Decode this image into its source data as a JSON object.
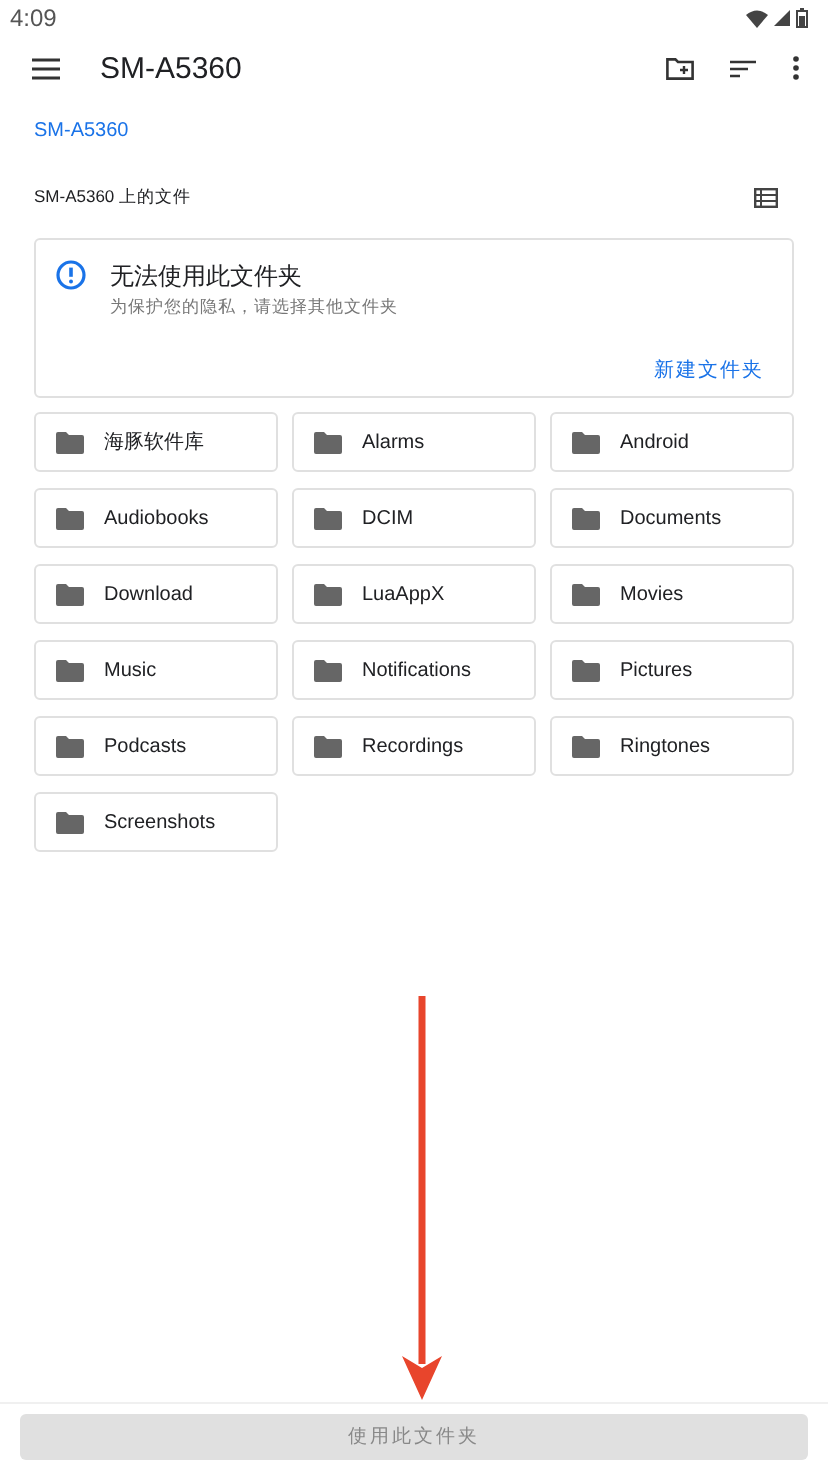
{
  "status_bar": {
    "time": "4:09"
  },
  "toolbar": {
    "title": "SM-A5360"
  },
  "breadcrumb": "SM-A5360",
  "section": {
    "title": "SM-A5360 上的文件"
  },
  "notice": {
    "title": "无法使用此文件夹",
    "message": "为保护您的隐私，请选择其他文件夹",
    "action": "新建文件夹"
  },
  "folders": [
    {
      "name": "海豚软件库"
    },
    {
      "name": "Alarms"
    },
    {
      "name": "Android"
    },
    {
      "name": "Audiobooks"
    },
    {
      "name": "DCIM"
    },
    {
      "name": "Documents"
    },
    {
      "name": "Download"
    },
    {
      "name": "LuaAppX"
    },
    {
      "name": "Movies"
    },
    {
      "name": "Music"
    },
    {
      "name": "Notifications"
    },
    {
      "name": "Pictures"
    },
    {
      "name": "Podcasts"
    },
    {
      "name": "Recordings"
    },
    {
      "name": "Ringtones"
    },
    {
      "name": "Screenshots"
    }
  ],
  "use_button": {
    "label": "使用此文件夹",
    "disabled": true
  }
}
